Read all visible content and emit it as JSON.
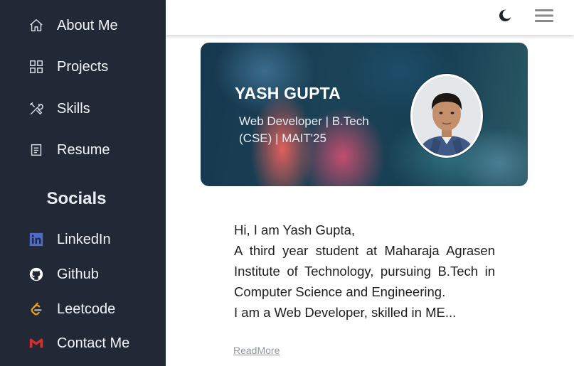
{
  "sidebar": {
    "nav": [
      {
        "label": "About Me",
        "icon": "home-icon"
      },
      {
        "label": "Projects",
        "icon": "grid-icon"
      },
      {
        "label": "Skills",
        "icon": "tools-icon"
      },
      {
        "label": "Resume",
        "icon": "document-icon"
      }
    ],
    "socials_title": "Socials",
    "socials": [
      {
        "label": "LinkedIn",
        "icon": "linkedin-icon",
        "color": "#4e6bc8"
      },
      {
        "label": "Github",
        "icon": "github-icon",
        "color": "#ffffff"
      },
      {
        "label": "Leetcode",
        "icon": "leetcode-icon",
        "color": "#f0a21b"
      },
      {
        "label": "Contact Me",
        "icon": "gmail-icon",
        "color": "#d82d2d"
      }
    ]
  },
  "topbar": {
    "theme_icon": "moon-icon",
    "menu_icon": "hamburger-icon"
  },
  "hero": {
    "name": "YASH GUPTA",
    "subtitle": "Web Developer | B.Tech (CSE) | MAIT'25"
  },
  "intro": {
    "greeting": "Hi, I am Yash Gupta,",
    "description": "A third year student at Maharaja Agrasen Institute of Technology, pursuing B.Tech in Computer Science and Engineering.",
    "skills_preview": "I am a Web Developer, skilled in ME...",
    "read_more": "ReadMore"
  },
  "colors": {
    "sidebar_bg": "#212936",
    "accent_text": "#1e1e1e"
  }
}
